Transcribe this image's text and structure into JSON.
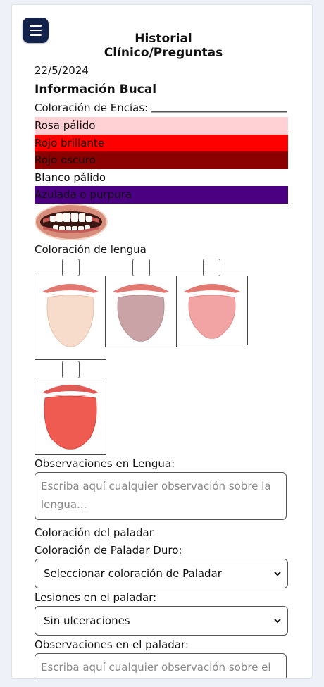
{
  "header": {
    "title": "Historial Clínico/Preguntas",
    "menu_icon": "hamburger-menu-icon"
  },
  "date": "22/5/2024",
  "section_title": "Información Bucal",
  "gums": {
    "label": "Coloración de Encías:",
    "options": [
      {
        "label": "Rosa pálido",
        "color": "#ffd1d4"
      },
      {
        "label": "Rojo brillante",
        "color": "#ff0000"
      },
      {
        "label": "Rojo oscuro",
        "color": "#8b0000"
      },
      {
        "label": "Blanco pálido",
        "color": "#ffffff"
      },
      {
        "label": "Azulada o purpura",
        "color": "#4b0082"
      }
    ]
  },
  "tongue": {
    "label": "Coloración de lengua",
    "options": [
      {
        "name": "pale",
        "color": "#f6d9c8"
      },
      {
        "name": "grayish",
        "color": "#c9a6a6"
      },
      {
        "name": "pink",
        "color": "#f2a0a0"
      },
      {
        "name": "red",
        "color": "#ef5a4f"
      }
    ]
  },
  "tongue_observations": {
    "label": "Observaciones en Lengua:",
    "placeholder": "Escriba aquí cualquier observación sobre la lengua..."
  },
  "palate": {
    "heading": "Coloración del paladar",
    "hard_label": "Coloración de Paladar Duro:",
    "hard_value": "Seleccionar coloración de Paladar",
    "lesions_label": "Lesiones en el paladar:",
    "lesions_value": "Sin ulceraciones",
    "observations_label": "Observaciones en el paladar:",
    "observations_placeholder": "Escriba aquí cualquier observación sobre el"
  }
}
